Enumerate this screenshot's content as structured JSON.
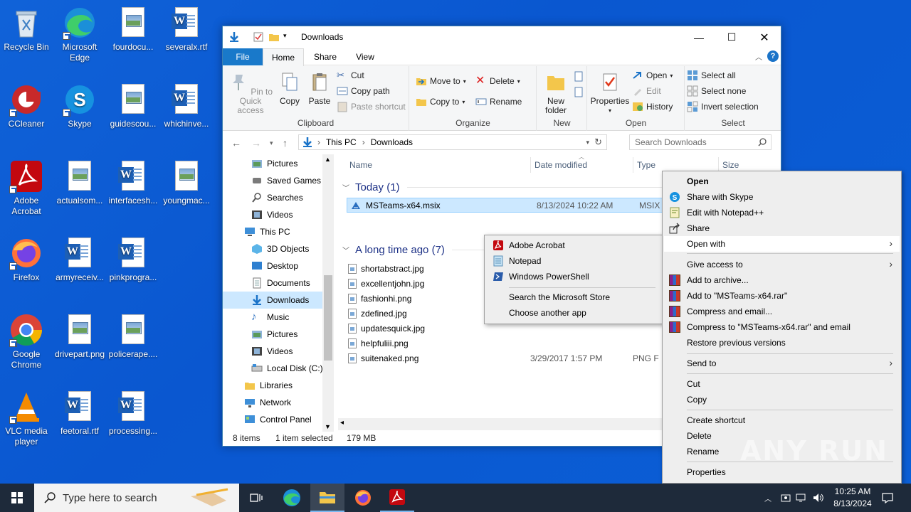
{
  "desktop": {
    "icons": [
      {
        "label": "Recycle Bin"
      },
      {
        "label": "Microsoft Edge"
      },
      {
        "label": "fourdocu..."
      },
      {
        "label": "severalx.rtf"
      },
      {
        "label": "CCleaner"
      },
      {
        "label": "Skype"
      },
      {
        "label": "guidescou..."
      },
      {
        "label": "whichinve..."
      },
      {
        "label": "Adobe Acrobat"
      },
      {
        "label": "actualsom..."
      },
      {
        "label": "interfacesh..."
      },
      {
        "label": "youngmac..."
      },
      {
        "label": "Firefox"
      },
      {
        "label": "armyreceiv..."
      },
      {
        "label": "pinkprogra..."
      },
      {
        "label": "Google Chrome"
      },
      {
        "label": "drivepart.png"
      },
      {
        "label": "policerape...."
      },
      {
        "label": "VLC media player"
      },
      {
        "label": "feetoral.rtf"
      },
      {
        "label": "processing..."
      }
    ]
  },
  "explorer": {
    "title": "Downloads",
    "tabs": {
      "file": "File",
      "home": "Home",
      "share": "Share",
      "view": "View"
    },
    "ribbon": {
      "clipboard": {
        "label": "Clipboard",
        "pin": "Pin to Quick access",
        "copy": "Copy",
        "paste": "Paste",
        "cut": "Cut",
        "copy_path": "Copy path",
        "paste_shortcut": "Paste shortcut"
      },
      "organize": {
        "label": "Organize",
        "move_to": "Move to",
        "copy_to": "Copy to",
        "delete": "Delete",
        "rename": "Rename"
      },
      "new": {
        "label": "New",
        "new_folder": "New folder"
      },
      "open": {
        "label": "Open",
        "properties": "Properties",
        "open": "Open",
        "edit": "Edit",
        "history": "History"
      },
      "select": {
        "label": "Select",
        "select_all": "Select all",
        "select_none": "Select none",
        "invert": "Invert selection"
      }
    },
    "address": {
      "this_pc": "This PC",
      "downloads": "Downloads",
      "search_placeholder": "Search Downloads"
    },
    "nav": [
      {
        "label": "Pictures"
      },
      {
        "label": "Saved Games"
      },
      {
        "label": "Searches"
      },
      {
        "label": "Videos"
      },
      {
        "label": "This PC"
      },
      {
        "label": "3D Objects"
      },
      {
        "label": "Desktop"
      },
      {
        "label": "Documents"
      },
      {
        "label": "Downloads"
      },
      {
        "label": "Music"
      },
      {
        "label": "Pictures"
      },
      {
        "label": "Videos"
      },
      {
        "label": "Local Disk (C:)"
      },
      {
        "label": "Libraries"
      },
      {
        "label": "Network"
      },
      {
        "label": "Control Panel"
      }
    ],
    "columns": {
      "name": "Name",
      "date": "Date modified",
      "type": "Type",
      "size": "Size"
    },
    "groups": {
      "today": "Today (1)",
      "longago": "A long time ago (7)"
    },
    "files_today": [
      {
        "name": "MSTeams-x64.msix",
        "date": "8/13/2024 10:22 AM",
        "type": "MSIX F"
      }
    ],
    "files_old": [
      {
        "name": "shortabstract.jpg"
      },
      {
        "name": "excellentjohn.jpg"
      },
      {
        "name": "fashionhi.png"
      },
      {
        "name": "zdefined.jpg"
      },
      {
        "name": "updatesquick.jpg"
      },
      {
        "name": "helpfuliii.png"
      },
      {
        "name": "suitenaked.png",
        "date": "3/29/2017 1:57 PM",
        "type": "PNG F"
      }
    ],
    "status": {
      "items": "8 items",
      "selected": "1 item selected",
      "size": "179 MB"
    }
  },
  "open_with_menu": {
    "items": [
      {
        "label": "Adobe Acrobat",
        "icon": "acrobat-icon"
      },
      {
        "label": "Notepad",
        "icon": "notepad-icon"
      },
      {
        "label": "Windows PowerShell",
        "icon": "powershell-icon"
      },
      {
        "label": "Search the Microsoft Store"
      },
      {
        "label": "Choose another app"
      }
    ]
  },
  "context_menu": {
    "open": "Open",
    "share_skype": "Share with Skype",
    "edit_notepadpp": "Edit with Notepad++",
    "share": "Share",
    "open_with": "Open with",
    "give_access": "Give access to",
    "add_archive": "Add to archive...",
    "add_rar": "Add to \"MSTeams-x64.rar\"",
    "compress_email": "Compress and email...",
    "compress_rar_email": "Compress to \"MSTeams-x64.rar\" and email",
    "restore": "Restore previous versions",
    "send_to": "Send to",
    "cut": "Cut",
    "copy": "Copy",
    "create_shortcut": "Create shortcut",
    "delete": "Delete",
    "rename": "Rename",
    "properties": "Properties"
  },
  "taskbar": {
    "search_placeholder": "Type here to search",
    "time": "10:25 AM",
    "date": "8/13/2024"
  },
  "watermark": "ANY RUN",
  "colors": {
    "accent": "#1979ca",
    "selection": "#cce8ff",
    "desktop": "#0b5fd6"
  }
}
